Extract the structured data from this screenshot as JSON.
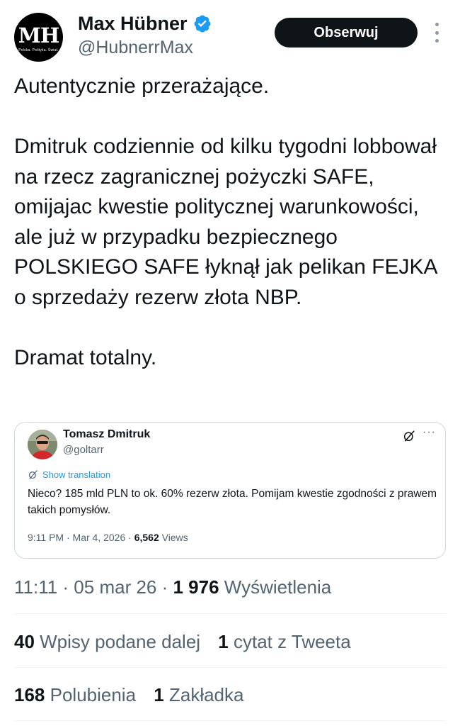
{
  "author": {
    "avatar_text": "MH",
    "avatar_tagline": "Polska. Polityka. Świat.",
    "name": "Max Hübner",
    "handle": "@HubnerrMax",
    "verified_icon": "verified-badge-icon",
    "verified_color": "#1d9bf0"
  },
  "follow_button": "Obserwuj",
  "tweet": {
    "paragraphs": [
      "Autentycznie przerażające.",
      "Dmitruk codziennie od kilku tygodni lobbował na rzecz zagranicznej pożyczki SAFE, omijajac kwestie politycznej warunkowości, ale już w przypadku bezpiecznego POLSKIEGO SAFE łyknął jak pelikan FEJKA o sprzedaży rezerw złota NBP.",
      "Dramat totalny."
    ]
  },
  "quote": {
    "name": "Tomasz Dmitruk",
    "handle": "@goltarr",
    "translate_label": "Show translation",
    "text": "Nieco? 185 mld PLN to ok. 60% rezerw złota. Pomijam kwestie zgodności z prawem takich pomysłów.",
    "time": "9:11 PM · Mar 4, 2026 · ",
    "views_count": "6,562",
    "views_label": " Views",
    "more": "···"
  },
  "meta": {
    "time": "11:11 · 05 mar 26 · ",
    "views_count": "1 976",
    "views_label": " Wyświetlenia"
  },
  "stats": {
    "retweets_count": "40",
    "retweets_label": " Wpisy podane dalej",
    "quotes_count": "1",
    "quotes_label": " cytat z Tweeta",
    "likes_count": "168",
    "likes_label": " Polubienia",
    "bookmarks_count": "1",
    "bookmarks_label": " Zakładka"
  },
  "colors": {
    "text": "#0f1419",
    "secondary": "#536471",
    "accent": "#1d9bf0",
    "border": "#cfd9de"
  }
}
